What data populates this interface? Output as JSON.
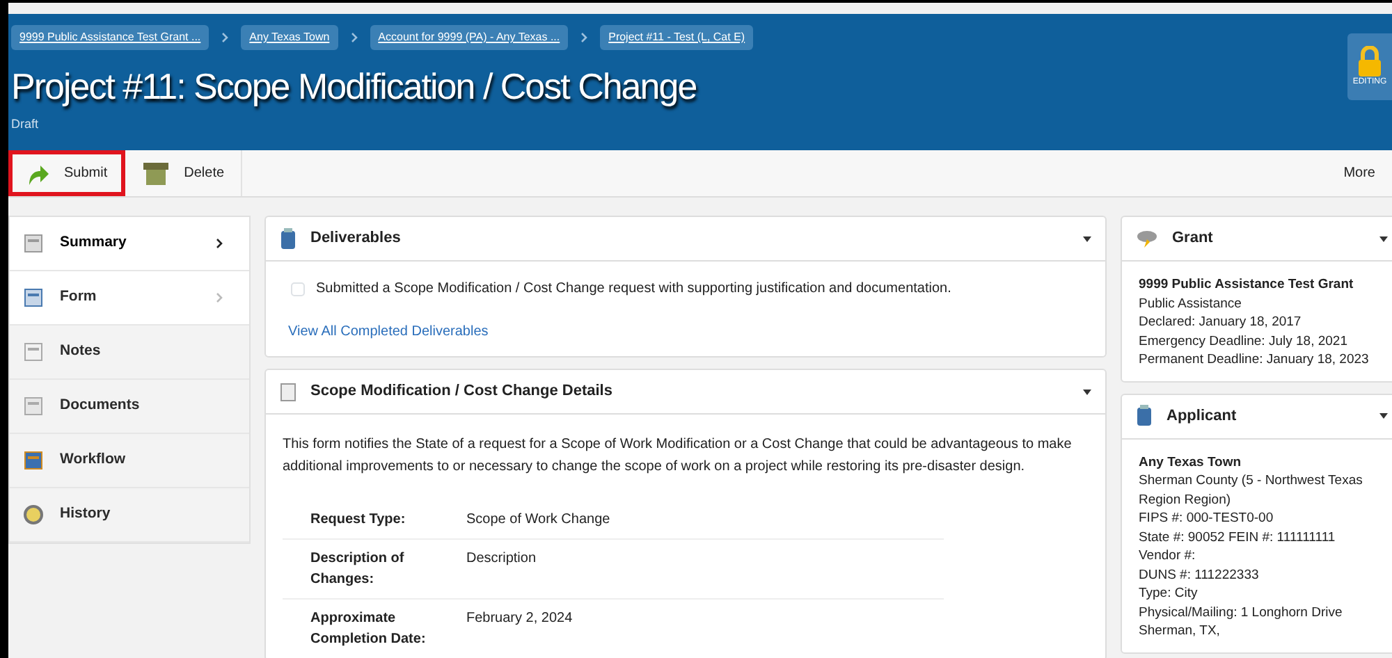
{
  "breadcrumbs": [
    "9999 Public Assistance Test Grant ...",
    "Any Texas Town",
    "Account for 9999 (PA) - Any Texas ...",
    "Project #11 - Test (L, Cat E)"
  ],
  "header": {
    "title": "Project #11: Scope Modification / Cost Change",
    "status": "Draft",
    "lock_label": "EDITING"
  },
  "toolbar": {
    "buttons": [
      {
        "label": "Submit",
        "kind": "submit",
        "highlighted": true
      },
      {
        "label": "Delete",
        "kind": "delete",
        "highlighted": false
      }
    ],
    "more": "More"
  },
  "sidebar": {
    "items": [
      {
        "label": "Summary",
        "kind": "summary",
        "expandable": true,
        "selected": true
      },
      {
        "label": "Form",
        "kind": "form",
        "expandable": true,
        "selected": false
      },
      {
        "label": "Notes",
        "kind": "notes",
        "expandable": false,
        "selected": false
      },
      {
        "label": "Documents",
        "kind": "documents",
        "expandable": false,
        "selected": false
      },
      {
        "label": "Workflow",
        "kind": "workflow",
        "expandable": false,
        "selected": false
      },
      {
        "label": "History",
        "kind": "history",
        "expandable": false,
        "selected": false
      }
    ]
  },
  "deliverables": {
    "title": "Deliverables",
    "items": [
      {
        "label": "Submitted a Scope Modification / Cost Change request with supporting justification and documentation.",
        "checked": false
      }
    ],
    "link": "View All Completed Deliverables"
  },
  "details": {
    "title": "Scope Modification / Cost Change Details",
    "intro": "This form notifies the State of a request for a Scope of Work Modification or a Cost Change that could be advantageous to make additional improvements to or necessary to change the scope of work on a project while restoring its pre-disaster design.",
    "fields": [
      {
        "label": "Request Type:",
        "value": "Scope of Work Change"
      },
      {
        "label": "Description of Changes:",
        "value": "Description"
      },
      {
        "label": "Approximate Completion Date:",
        "value": "February 2, 2024"
      }
    ]
  },
  "grant": {
    "title": "Grant",
    "name": "9999 Public Assistance Test Grant",
    "lines": [
      "Public Assistance",
      "Declared: January 18, 2017",
      "Emergency Deadline: July 18, 2021",
      "Permanent Deadline: January 18, 2023"
    ]
  },
  "applicant": {
    "title": "Applicant",
    "name": "Any Texas Town",
    "lines": [
      "Sherman County (5 - Northwest Texas Region Region)",
      "FIPS #: 000-TEST0-00",
      "State #: 90052 FEIN #: 111111111",
      "Vendor #:",
      "DUNS #: 111222333",
      "Type: City",
      "Physical/Mailing: 1 Longhorn Drive",
      "Sherman, TX,"
    ]
  }
}
